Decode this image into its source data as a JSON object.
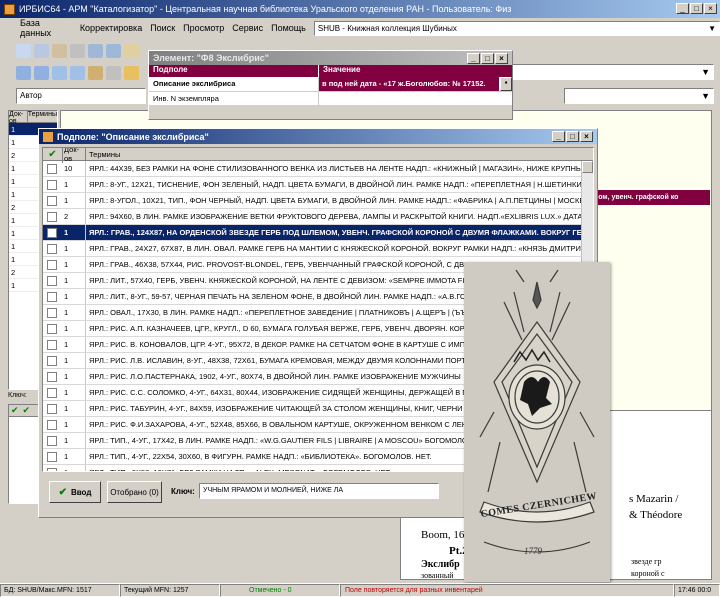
{
  "app": {
    "title": "ИРБИС64 - АРМ \"Каталогизатор\" - Центральная научная библиотека Уральского отделения РАН - Пользователь: Физ"
  },
  "menu": {
    "items": [
      "База данных",
      "Корректировка",
      "Поиск",
      "Просмотр",
      "Сервис",
      "Помощь"
    ],
    "db_value": "SHUB - Книжная коллекция Шубиных"
  },
  "search": {
    "field": "Автор"
  },
  "left_panel": {
    "col1": "Док-ов",
    "col2": "Термины",
    "numbers": [
      "1",
      "1",
      "2",
      "1",
      "1",
      "1",
      "2",
      "1",
      "1",
      "1",
      "1",
      "2",
      "1"
    ],
    "key_label": "Ключ:"
  },
  "element_window": {
    "title": "Элемент: \"Ф8 Экслибрис\"",
    "col_field": "Подполе",
    "col_value": "Значение",
    "rows": [
      {
        "field": "Описание экслибриса",
        "value": "в под ней дата - «17 ж.Боголюбов: № 17152."
      },
      {
        "field": "Инв. N экземпляра",
        "value": ""
      }
    ]
  },
  "right_strip_value": "пом, увенч. графской ко",
  "subfield_window": {
    "title": "Подполе: \"Описание экслибриса\"",
    "col1": "Док-ов",
    "col2": "Термины",
    "rows": [
      {
        "n": "10",
        "text": "ЯРЛ.: 44Х39, БЕЗ РАМКИ НА ФОНЕ СТИЛИЗОВАННОГО ВЕНКА ИЗ ЛИСТЬЕВ НА ЛЕНТЕ НАДП.: «КНИЖНЫЙ | МАГАЗИН», НИЖЕ КРУПНЫ"
      },
      {
        "n": "1",
        "text": "ЯРЛ.: 8-УГ., 12Х21, ТИСНЕНИЕ, ФОН ЗЕЛЕНЫЙ, НАДП. ЦВЕТА БУМАГИ, В ДВОЙНОЙ ЛИН. РАМКЕ НАДП.: «ПЕРЕПЛЕТНАЯ | Н.ШЕТИНКИНА"
      },
      {
        "n": "1",
        "text": "ЯРЛ.: 8-УГОЛ., 10Х21, ТИП., ФОН ЧЕРНЫЙ, НАДП. ЦВЕТА БУМАГИ, В ДВОЙНОЙ ЛИН. РАМКЕ НАДП.: «ФАБРИКА | А.П.ПЕТЦИНЫ | МОСКВЕ"
      },
      {
        "n": "2",
        "text": "ЯРЛ.: 94Х60, В ЛИН. РАМКЕ ИЗОБРАЖЕНИЕ ВЕТКИ ФРУКТОВОГО ДЕРЕВА, ЛАМПЫ И РАСКРЫТОЙ КНИГИ. НАДП.«EXLIBRIS LUX.» ДАТА"
      },
      {
        "n": "1",
        "text": "ЯРЛ.: ГРАВ., 124Х87, НА ОРДЕНСКОЙ ЗВЕЗДЕ ГЕРБ ПОД ШЛЕМОМ, УВЕНЧ. ГРАФСКОЙ КОРОНОЙ С ДВУМЯ ФЛАЖКАМИ. ВОКРУГ ГЕРБА"
      },
      {
        "n": "1",
        "text": "ЯРЛ.: ГРАВ., 24Х27, 67Х87, В ЛИН. ОВАЛ. РАМКЕ ГЕРБ НА МАНТИИ С КНЯЖЕСКОЙ КОРОНОЙ. ВОКРУГ РАМКИ НАДП.: «КНЯЗЬ ДМИТРИЙ"
      },
      {
        "n": "1",
        "text": "ЯРЛ.: ГРАВ., 46Х38, 57Х44, РИС. PROVOST-BLONDEL, ГЕРБ, УВЕНЧАННЫЙ ГРАФСКОЙ КОРОНОЙ, С ДВУМЯ"
      },
      {
        "n": "1",
        "text": "ЯРЛ.: ЛИТ., 57Х40, ГЕРБ, УВЕНЧ. КНЯЖЕСКОЙ КОРОНОЙ, НА ЛЕНТЕ С ДЕВИЗОМ: «SEMPRE IMMOTA FIDES"
      },
      {
        "n": "1",
        "text": "ЯРЛ.: ЛИТ., 8-УГ., 59-57, ЧЕРНАЯ ПЕЧАТЬ НА ЗЕЛЕНОМ ФОНЕ, В ДВОЙНОЙ ЛИН. РАМКЕ НАДП.: «А.В.ГОЛО"
      },
      {
        "n": "1",
        "text": "ЯРЛ.: ОВАЛ., 17Х30, В ЛИН. РАМКЕ НАДП.: «ПЕРЕПЛЕТНОЕ ЗАВЕДЕНИЕ | ПЛАТНИКОВЪ | А.ЩЕРЪ | (ЪЪ Н"
      },
      {
        "n": "1",
        "text": "ЯРЛ.: РИС. А.П. КАЗНАЧЕЕВ, ЦГР., КРУГЛ., D 60, БУМАГА ГОЛУБАЯ ВЕРЖЕ, ГЕРБ, УВЕНЧ. ДВОРЯН. КОРОН"
      },
      {
        "n": "1",
        "text": "ЯРЛ.: РИС. В. КОНОВАЛОВ, ЦГР. 4-УГ., 95Х72, В ДЕКОР. РАМКЕ НА СЕТЧАТОМ ФОНЕ В КАРТУШЕ С ИМП. К"
      },
      {
        "n": "1",
        "text": "ЯРЛ.: РИС. Л.В. ИСЛАВИН, 8-УГ., 48Х38, 72Х61, БУМАГА КРЕМОВАЯ, МЕЖДУ ДВУМЯ КОЛОННАМИ ПОРТ"
      },
      {
        "n": "1",
        "text": "ЯРЛ.: РИС. Л.О.ПАСТЕРНАКА, 1902, 4-УГ., 80Х74, В ДВОЙНОЙ ЛИН. РАМКЕ ИЗОБРАЖЕНИЕ МУЖЧИНЫ"
      },
      {
        "n": "1",
        "text": "ЯРЛ.: РИС. С.С. СОЛОМКО, 4-УГ., 64Х31, 80Х44, ИЗОБРАЖЕНИЕ СИДЯЩЕЙ ЖЕНЩИНЫ, ДЕРЖАЩЕЙ В Г"
      },
      {
        "n": "1",
        "text": "ЯРЛ.: РИС. ТАБУРИН, 4-УГ., 84Х59, ИЗОБРАЖЕНИЕ ЧИТАЮЩЕЙ ЗА СТОЛОМ ЖЕНЩИНЫ, КНИГ, ЧЕРНИ"
      },
      {
        "n": "1",
        "text": "ЯРЛ.: РИС. Ф.И.ЗАХАРОВА, 4-УГ., 52Х48, 85Х66, В ОВАЛЬНОМ КАРТУШЕ, ОКРУЖЕННОМ ВЕНКОМ С ЛЕНТ"
      },
      {
        "n": "1",
        "text": "ЯРЛ.: ТИП., 4-УГ., 17Х42, В ЛИН. РАМКЕ НАДП.: «W.G.GAUTIER FILS | LIBRAIRE | A MOSCOU» БОГОМОЛОВ"
      },
      {
        "n": "1",
        "text": "ЯРЛ.: ТИП., 4-УГ., 22Х54, 30Х60, В ФИГУРН. РАМКЕ НАДП.: «БИБЛИОТЕКА». БОГОМОЛОВ. НЕТ."
      },
      {
        "n": "1",
        "text": "ЯРЛ.: ТИП., 8Х58, 19Х71, БЕЗ РАМКИ НАДП.: «ALEX. MESONAT». БОГОМОЛОВ. НЕТ."
      }
    ],
    "btn_enter": "Ввод",
    "btn_selected": "Отобрано (0)",
    "key_label": "Ключ:",
    "key_value": "УЧНЫМ ЯРАМОМ И МОЛНИЕЙ, НИЖЕ ЛА"
  },
  "doc_text": {
    "line1": "s Mazarin /",
    "line2": "& Théodore",
    "line3": "Boom, 16",
    "line4": "Pt.2",
    "line5": "Экслибр",
    "line6": "зованный",
    "line7": "звезде гр",
    "line8": "короной с"
  },
  "bookplate": {
    "inscription": "COMES CZERNICHEW",
    "year": "1779"
  },
  "status": {
    "db": "БД: SHUB/Макс.MFN: 1517",
    "mfn": "Текущий MFN: 1257",
    "marked": "Отмечено - 0",
    "note": "Поле повторяется для разных инвентарей",
    "time": "17:46 00:0"
  },
  "colors": {
    "titlebar": "#0a246a",
    "selection": "#0a246a",
    "highlight_row": "#800040",
    "window_bg": "#d4d0c8"
  }
}
